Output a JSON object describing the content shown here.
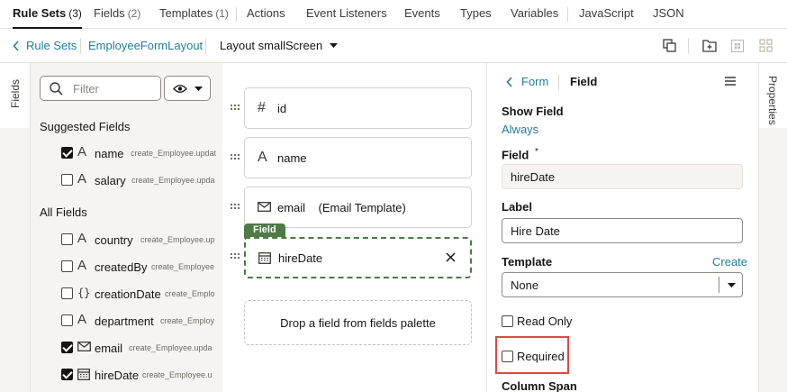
{
  "top_tabs": [
    {
      "label": "Rule Sets",
      "count": "(3)"
    },
    {
      "label": "Fields",
      "count": "(2)"
    },
    {
      "label": "Templates",
      "count": "(1)"
    },
    {
      "label": "Actions"
    },
    {
      "label": "Event Listeners"
    },
    {
      "label": "Events"
    },
    {
      "label": "Types"
    },
    {
      "label": "Variables"
    },
    {
      "label": "JavaScript"
    },
    {
      "label": "JSON"
    }
  ],
  "breadcrumb": {
    "back": "Rule Sets",
    "layout": "EmployeeFormLayout",
    "current": "Layout smallScreen"
  },
  "fields_tab_label": "Fields",
  "palette": {
    "filter_placeholder": "Filter",
    "suggested_heading": "Suggested Fields",
    "all_heading": "All Fields",
    "suggested": [
      {
        "name": "name",
        "type_icon": "text-icon",
        "expr": "create_Employee.updat",
        "checked": true
      },
      {
        "name": "salary",
        "type_icon": "text-icon",
        "expr": "create_Employee.upda",
        "checked": false
      }
    ],
    "all": [
      {
        "name": "country",
        "type_icon": "text-icon",
        "expr": "create_Employee.up",
        "checked": false
      },
      {
        "name": "createdBy",
        "type_icon": "text-icon",
        "expr": "create_Employee",
        "checked": false
      },
      {
        "name": "creationDate",
        "type_icon": "object-icon",
        "expr": "create_Emplo",
        "checked": false
      },
      {
        "name": "department",
        "type_icon": "text-icon",
        "expr": "create_Employ",
        "checked": false
      },
      {
        "name": "email",
        "type_icon": "email-icon",
        "expr": "create_Employee.upda",
        "checked": true
      },
      {
        "name": "hireDate",
        "type_icon": "calendar-icon",
        "expr": "create_Employee.u",
        "checked": true
      }
    ]
  },
  "canvas": {
    "cards": [
      {
        "label": "id",
        "icon": "hash-icon"
      },
      {
        "label": "name",
        "icon": "text-icon"
      },
      {
        "label": "email    (Email Template)",
        "icon": "email-icon"
      },
      {
        "label": "hireDate",
        "icon": "calendar-icon",
        "selected": true,
        "badge": "Field"
      }
    ],
    "dropzone": "Drop a field from fields palette"
  },
  "properties": {
    "back": "Form",
    "title": "Field",
    "show_field_label": "Show Field",
    "show_field_value": "Always",
    "field_label": "Field",
    "field_required_mark": "*",
    "field_value": "hireDate",
    "label_label": "Label",
    "label_value": "Hire Date",
    "template_label": "Template",
    "template_create": "Create",
    "template_value": "None",
    "read_only": "Read Only",
    "required": "Required",
    "column_span": "Column Span"
  },
  "properties_tab_label": "Properties",
  "colors": {
    "accent": "#227e9e",
    "selected_green": "#4e7a45",
    "highlight_red": "#e04848"
  }
}
